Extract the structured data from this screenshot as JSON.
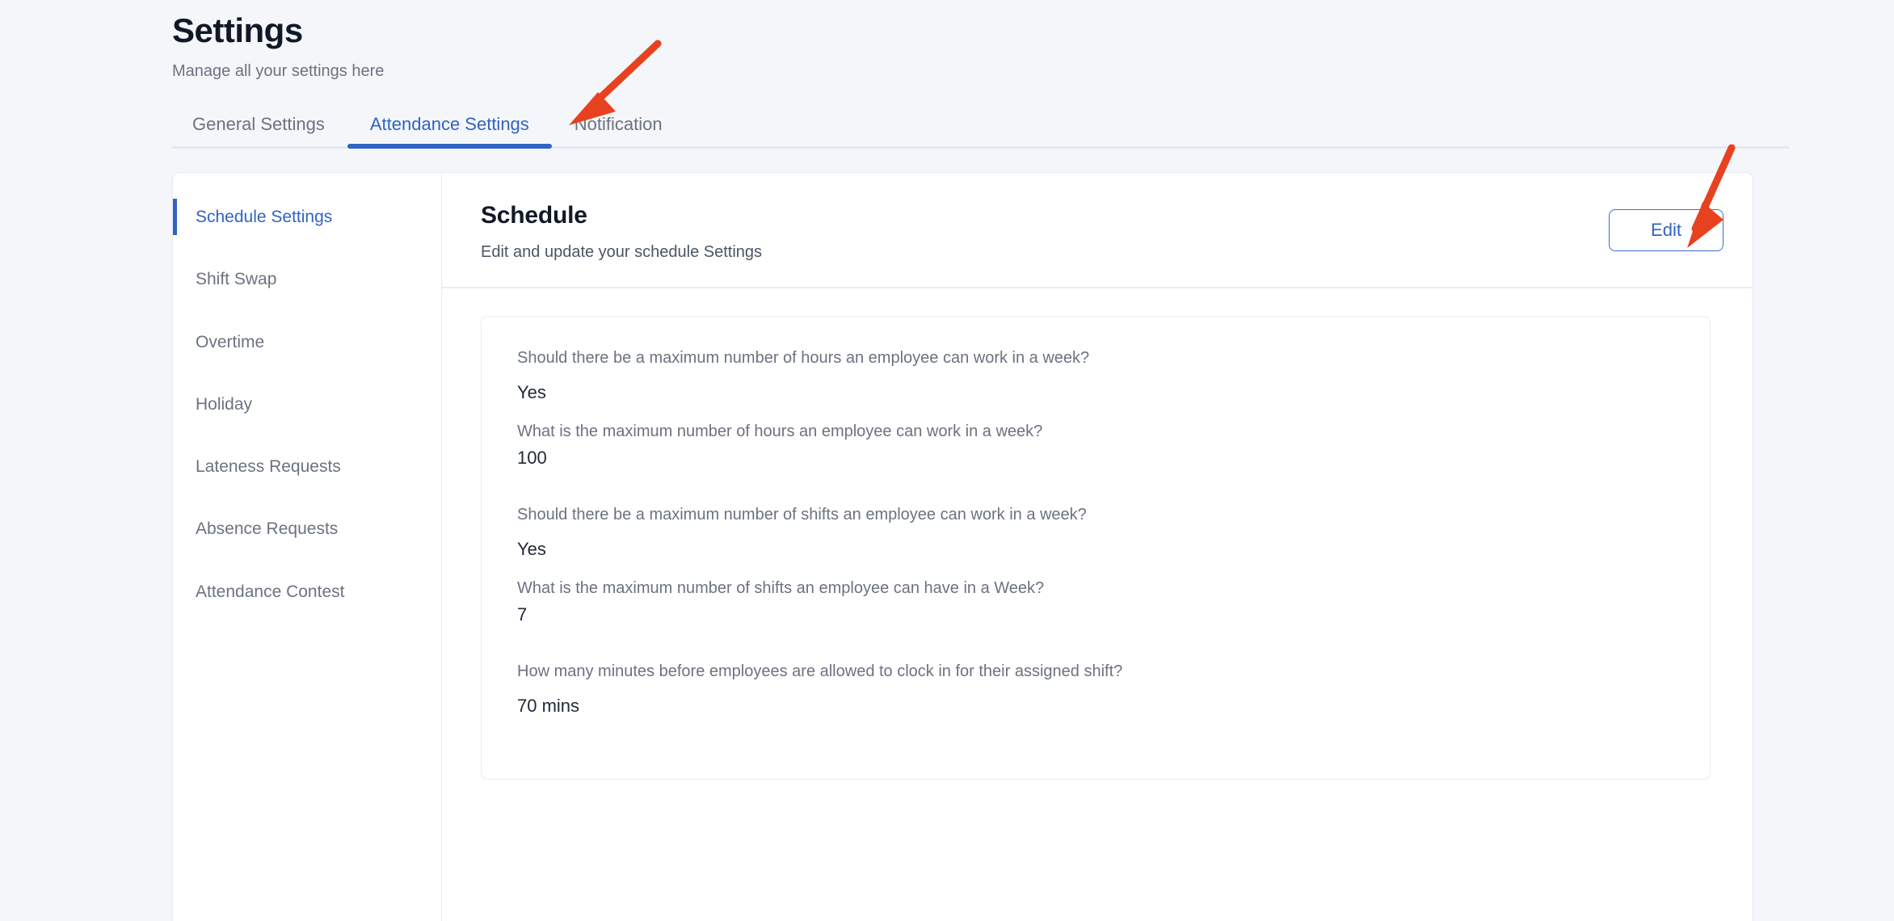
{
  "header": {
    "title": "Settings",
    "subtitle": "Manage all your settings here"
  },
  "tabs": [
    {
      "label": "General Settings",
      "active": false
    },
    {
      "label": "Attendance Settings",
      "active": true
    },
    {
      "label": "Notification",
      "active": false
    }
  ],
  "sidenav": {
    "items": [
      {
        "label": "Schedule Settings",
        "active": true
      },
      {
        "label": "Shift Swap",
        "active": false
      },
      {
        "label": "Overtime",
        "active": false
      },
      {
        "label": "Holiday",
        "active": false
      },
      {
        "label": "Lateness Requests",
        "active": false
      },
      {
        "label": "Absence Requests",
        "active": false
      },
      {
        "label": "Attendance Contest",
        "active": false
      }
    ]
  },
  "section": {
    "title": "Schedule",
    "description": "Edit and update your schedule Settings",
    "edit_label": "Edit"
  },
  "settings": {
    "group1": {
      "question": "Should there be a maximum number of hours an employee can work in a week?",
      "answer": "Yes",
      "sub_question": "What is the maximum number of hours an employee can work in a week?",
      "sub_answer": "100"
    },
    "group2": {
      "question": "Should there be a maximum number of shifts an employee can work in a week?",
      "answer": "Yes",
      "sub_question": "What is the maximum number of shifts an employee can have in a Week?",
      "sub_answer": "7"
    },
    "group3": {
      "question": "How many minutes before employees are allowed to clock in for their assigned shift?",
      "answer": "70 mins"
    }
  },
  "annotations": {
    "arrow_color": "#e8411f",
    "arrow_tab_target": "Attendance Settings",
    "arrow_button_target": "Edit"
  },
  "colors": {
    "accent": "#2f63c4",
    "page_background": "#f4f6fa",
    "panel_background": "#ffffff",
    "muted_text": "#6b7280"
  }
}
